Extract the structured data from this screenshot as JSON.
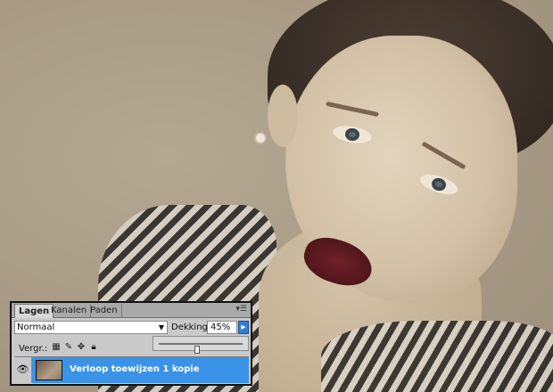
{
  "layers_panel": {
    "tabs": [
      {
        "label": "Lagen",
        "active": true
      },
      {
        "label": "Kanalen",
        "active": false
      },
      {
        "label": "Paden",
        "active": false
      }
    ],
    "blend_mode": "Normaal",
    "opacity_label": "Dekking:",
    "opacity_value": "45%",
    "opacity_slider_fraction": 0.45,
    "lock_label": "Vergr.:",
    "layer": {
      "name": "Verloop toewijzen 1 kopie",
      "visible": true,
      "selected": true
    }
  },
  "colors": {
    "selection": "#3b93e8",
    "panel_bg": "#c9c9c9"
  }
}
